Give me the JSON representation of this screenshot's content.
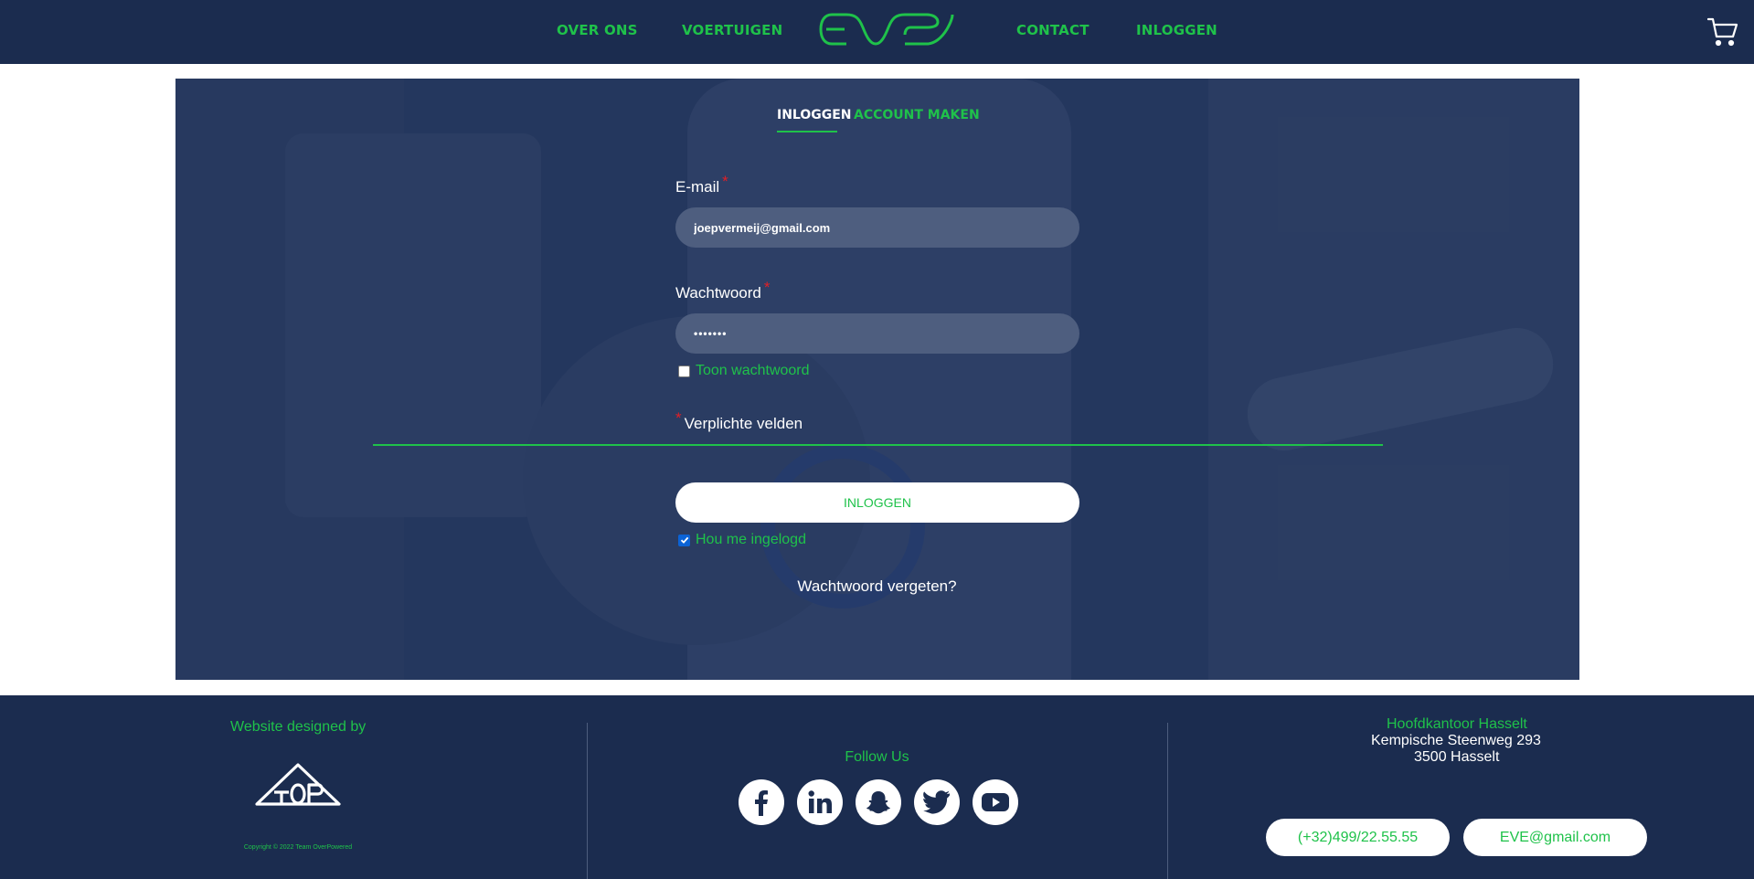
{
  "nav": {
    "about": "OVER ONS",
    "vehicles": "VOERTUIGEN",
    "contact": "CONTACT",
    "login": "INLOGGEN",
    "logo_text": "EVE",
    "cart_icon": "shopping-cart-icon"
  },
  "tabs": {
    "login": "INLOGGEN",
    "register": "ACCOUNT MAKEN"
  },
  "form": {
    "email_label": "E-mail",
    "email_value": "joepvermeij@gmail.com",
    "password_label": "Wachtwoord",
    "password_value": "•••••••",
    "required_marker": "*",
    "show_password": "Toon wachtwoord",
    "show_password_checked": false,
    "required_fields": "Verplichte velden",
    "login_button": "INLOGGEN",
    "remember_me": "Hou me ingelogd",
    "remember_me_checked": true,
    "forgot_password": "Wachtwoord vergeten?"
  },
  "footer": {
    "designed_by": "Website designed by",
    "designer_logo_text": "TOP",
    "copyright": "Copyright © 2022 Team OverPowered",
    "follow_us": "Follow Us",
    "socials": [
      "facebook-icon",
      "linkedin-icon",
      "snapchat-icon",
      "twitter-icon",
      "youtube-icon"
    ],
    "office_title": "Hoofdkantoor Hasselt",
    "address_line1": "Kempische Steenweg 293",
    "address_line2": "3500 Hasselt",
    "phone": "(+32)499/22.55.55",
    "email": "EVE@gmail.com"
  },
  "colors": {
    "navy": "#1b2c4f",
    "accent_green": "#1fc24a",
    "required_red": "#e21f26"
  }
}
